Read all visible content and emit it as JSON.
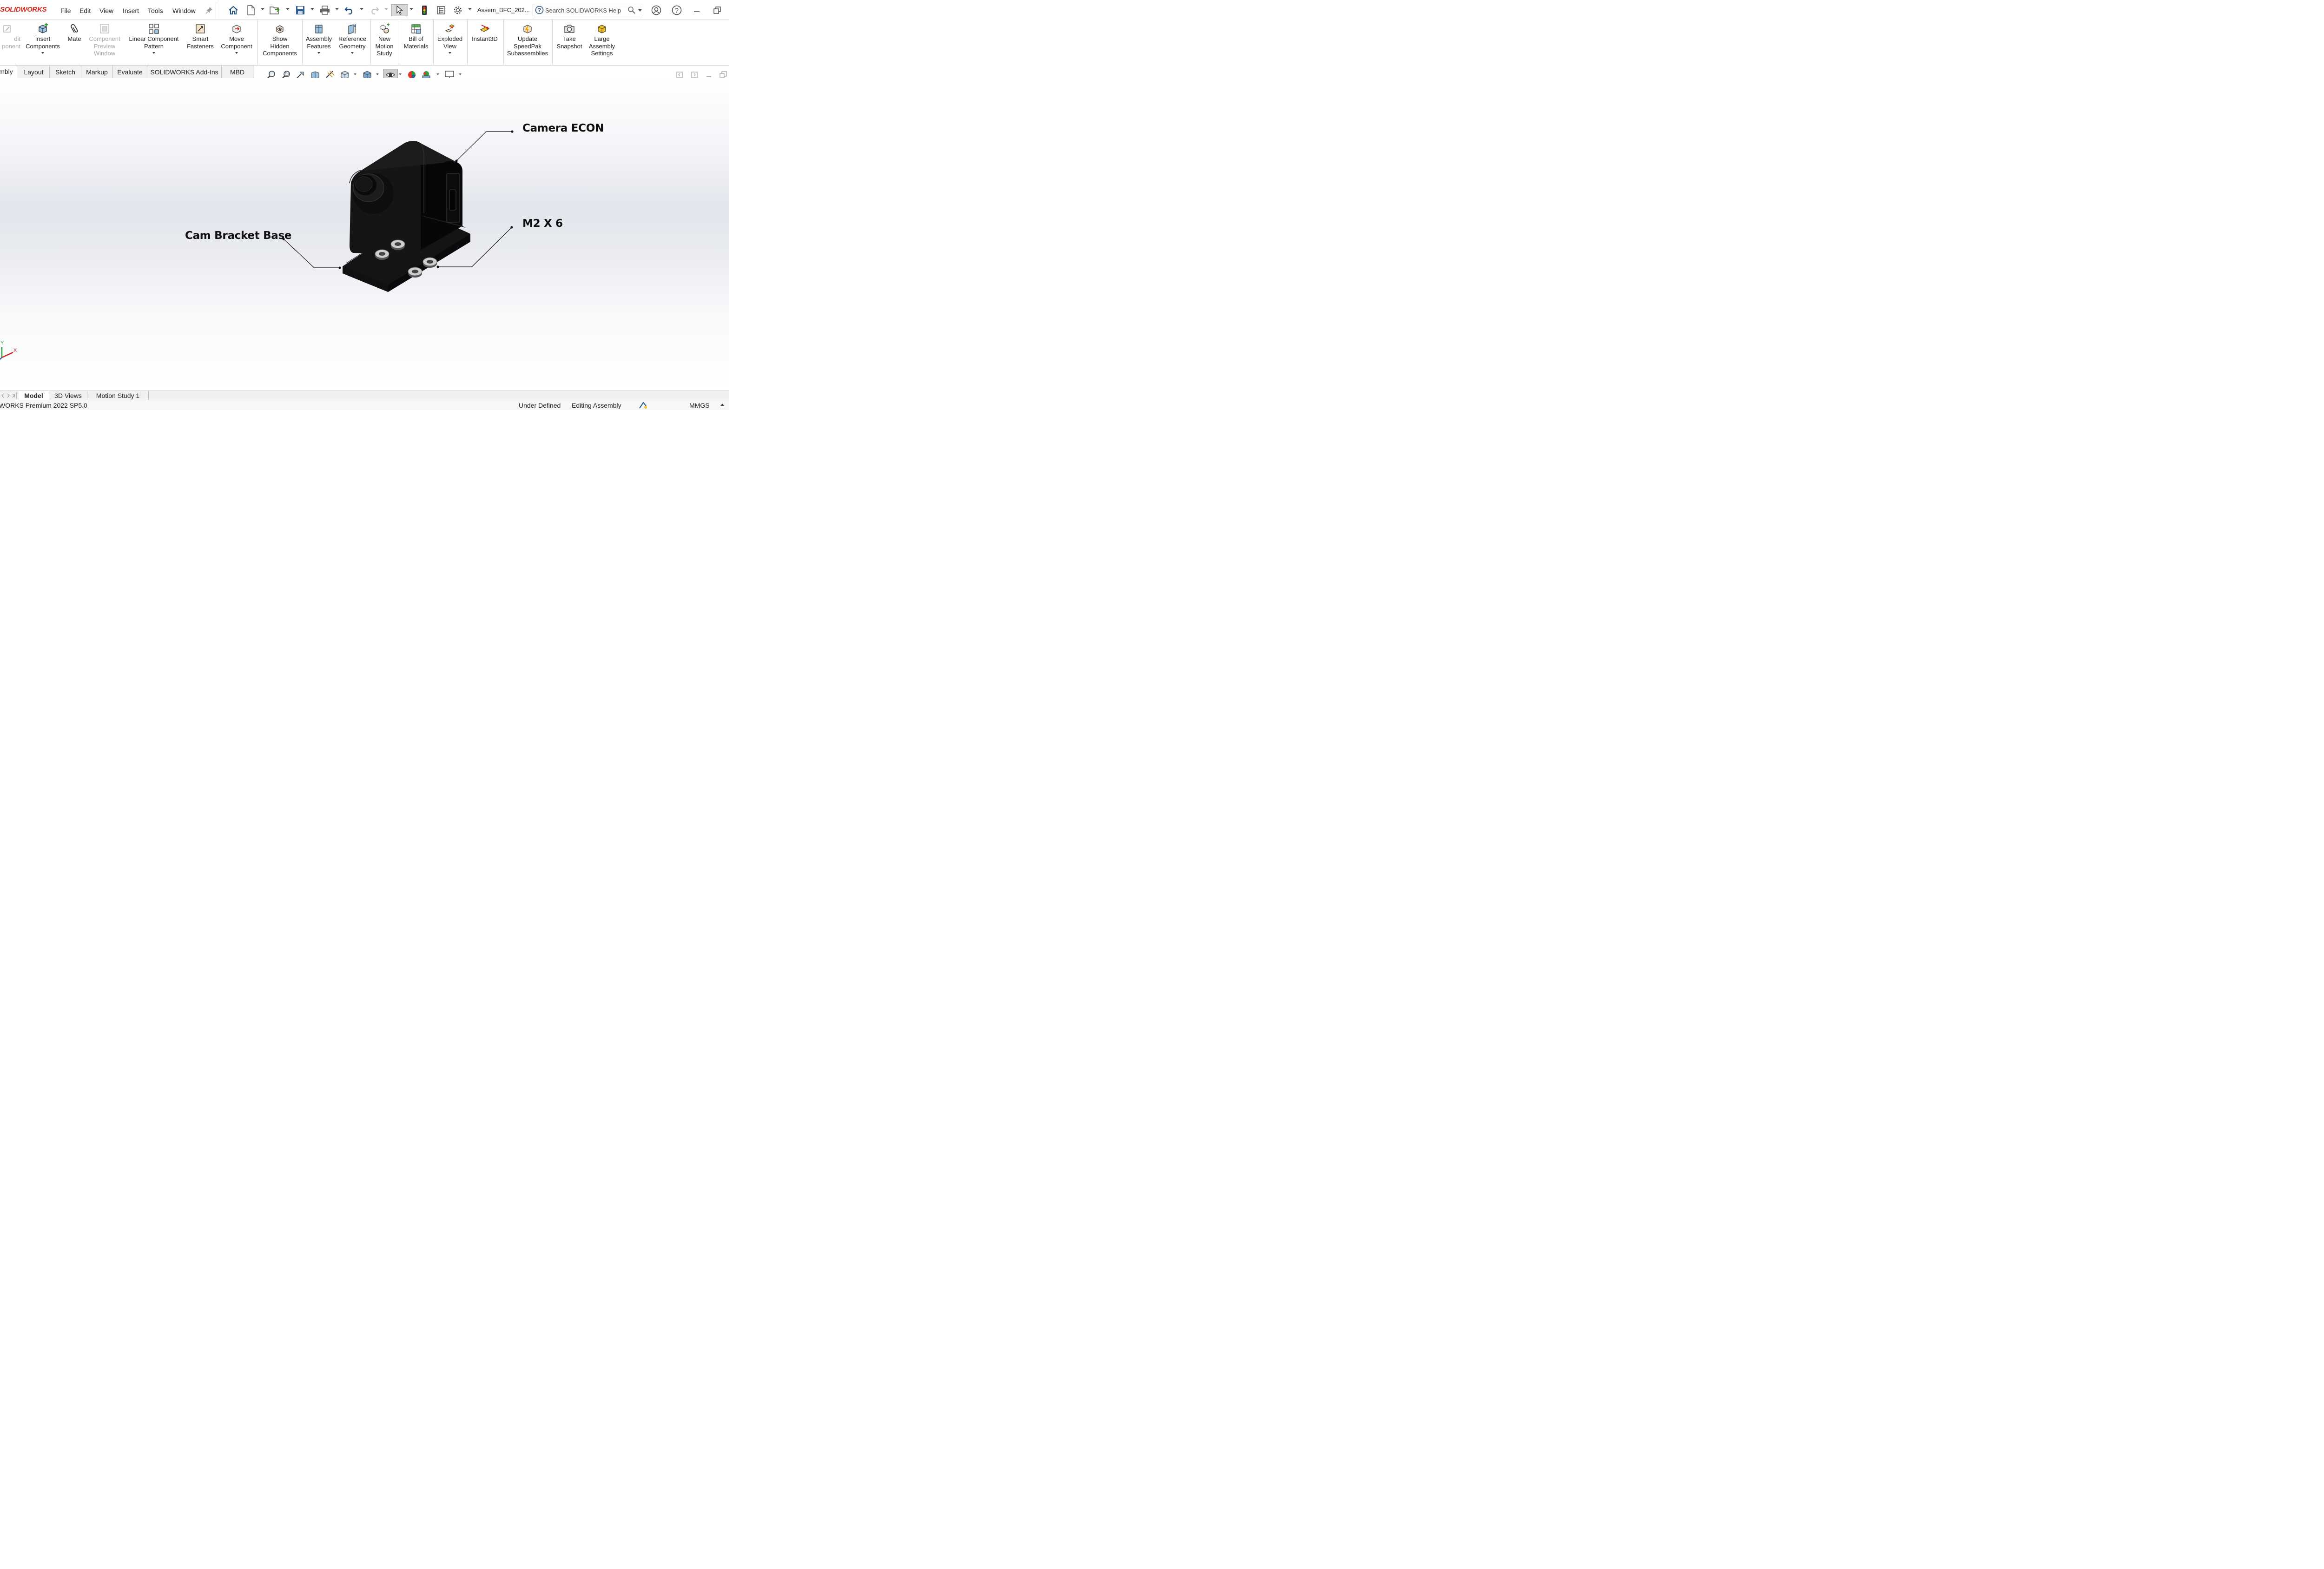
{
  "app": {
    "logo": "SOLIDWORKS",
    "menus": [
      "File",
      "Edit",
      "View",
      "Insert",
      "Tools",
      "Window"
    ],
    "doc_title": "Assem_BFC_202...",
    "search_placeholder": "Search SOLIDWORKS Help"
  },
  "quick_access": [
    "home-icon",
    "new-document-icon",
    "open-icon",
    "save-icon",
    "print-icon",
    "undo-icon",
    "redo-icon",
    "select-pointer-icon",
    "rebuild-traffic-light-icon",
    "file-properties-icon",
    "options-gear-icon"
  ],
  "command_manager": {
    "buttons": [
      {
        "label": "dit\nponent",
        "icon": "edit-component-icon",
        "disabled": true
      },
      {
        "label": "Insert\nComponents",
        "icon": "insert-components-icon"
      },
      {
        "label": "Mate",
        "icon": "mate-paperclip-icon"
      },
      {
        "label": "Component\nPreview\nWindow",
        "icon": "preview-window-icon",
        "disabled": true
      },
      {
        "label": "Linear Component\nPattern",
        "icon": "linear-pattern-icon"
      },
      {
        "label": "Smart\nFasteners",
        "icon": "smart-fasteners-icon"
      },
      {
        "label": "Move\nComponent",
        "icon": "move-component-icon"
      },
      {
        "label": "Show\nHidden\nComponents",
        "icon": "show-hidden-icon"
      },
      {
        "label": "Assembly\nFeatures",
        "icon": "assembly-features-icon"
      },
      {
        "label": "Reference\nGeometry",
        "icon": "reference-geometry-icon"
      },
      {
        "label": "New\nMotion\nStudy",
        "icon": "motion-study-icon"
      },
      {
        "label": "Bill of\nMaterials",
        "icon": "bill-of-materials-icon"
      },
      {
        "label": "Exploded\nView",
        "icon": "exploded-view-icon"
      },
      {
        "label": "Instant3D",
        "icon": "instant3d-icon"
      },
      {
        "label": "Update\nSpeedPak\nSubassemblies",
        "icon": "speedpak-icon"
      },
      {
        "label": "Take\nSnapshot",
        "icon": "camera-snapshot-icon"
      },
      {
        "label": "Large\nAssembly\nSettings",
        "icon": "large-assembly-icon"
      }
    ]
  },
  "tabs": [
    "mbly",
    "Layout",
    "Sketch",
    "Markup",
    "Evaluate",
    "SOLIDWORKS Add-Ins",
    "MBD"
  ],
  "active_tab": "mbly",
  "heads_up_toolbar": [
    "zoom-to-fit-icon",
    "zoom-to-area-icon",
    "previous-view-icon",
    "section-view-icon",
    "dynamic-annotation-icon",
    "view-orientation-icon",
    "display-style-icon",
    "hide-show-items-icon",
    "edit-appearance-icon",
    "apply-scene-icon",
    "view-settings-icon"
  ],
  "annotations": {
    "camera": "Camera ECON",
    "base": "Cam Bracket Base",
    "screw": "M2 X 6"
  },
  "triad": {
    "x": "X",
    "y": "Y"
  },
  "bottom_tabs": [
    "Model",
    "3D Views",
    "Motion Study 1"
  ],
  "active_bottom_tab": "Model",
  "status": {
    "version": "WORKS Premium 2022 SP5.0",
    "defined_state": "Under Defined",
    "mode": "Editing Assembly",
    "units": "MMGS"
  },
  "colors": {
    "brand": "#da291c",
    "model": "#0d0d0d",
    "callout_text": "#111111"
  }
}
